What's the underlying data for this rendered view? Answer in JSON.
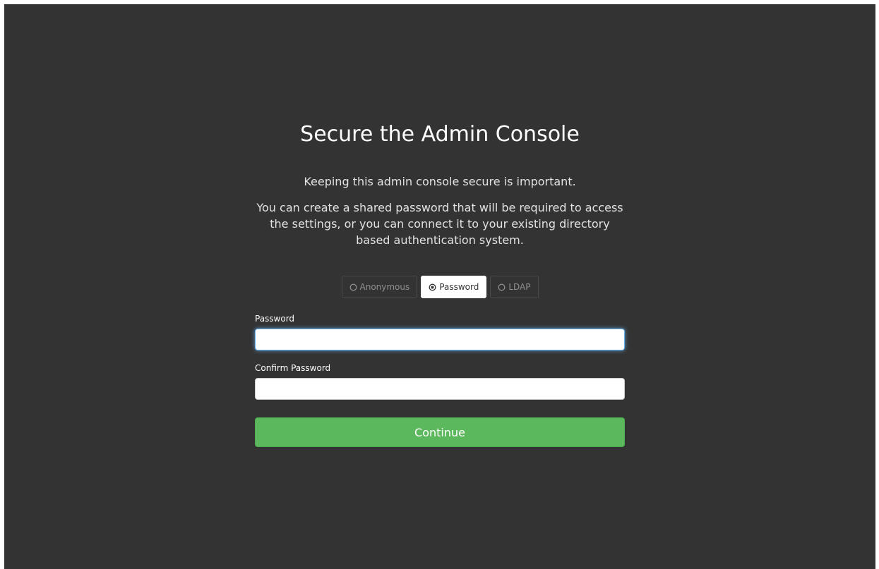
{
  "page": {
    "title": "Secure the Admin Console",
    "intro": "Keeping this admin console secure is important.",
    "description": "You can create a shared password that will be required to access the settings, or you can connect it to your existing directory based authentication system."
  },
  "auth_options": {
    "selected": "Password",
    "items": [
      {
        "label": "Anonymous",
        "icon": "radio-unchecked-icon"
      },
      {
        "label": "Password",
        "icon": "radio-checked-icon"
      },
      {
        "label": "LDAP",
        "icon": "radio-unchecked-icon"
      }
    ]
  },
  "form": {
    "password_label": "Password",
    "password_value": "",
    "confirm_label": "Confirm Password",
    "confirm_value": "",
    "continue_label": "Continue"
  },
  "colors": {
    "background": "#333333",
    "accent_green": "#5cb85c",
    "focus_blue": "#66afe9"
  }
}
